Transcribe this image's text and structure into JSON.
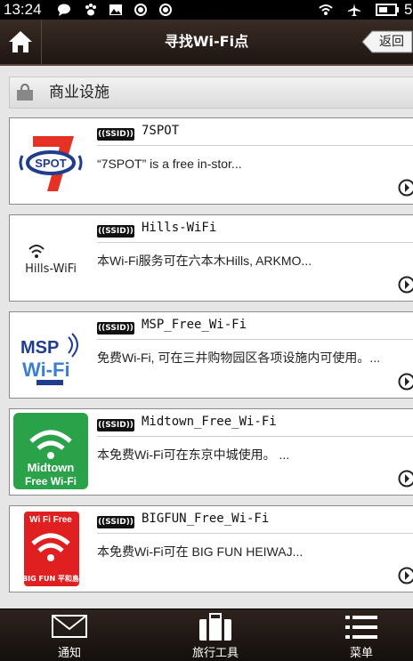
{
  "status_bar": {
    "time": "13:24",
    "battery_partial": "5"
  },
  "header": {
    "title": "寻找Wi-Fi点",
    "back_label": "返回"
  },
  "section": {
    "label": "商业设施"
  },
  "spots": [
    {
      "badge": "SSID",
      "ssid": "7SPOT",
      "desc": "“7SPOT” is a free in-stor...",
      "logo_text": "SPOT"
    },
    {
      "badge": "SSID",
      "ssid": "Hills-WiFi",
      "desc": "本Wi-Fi服务可在六本木Hills, ARKMO...",
      "logo_text": "Hills-WiFi"
    },
    {
      "badge": "SSID",
      "ssid": "MSP_Free_Wi-Fi",
      "desc": "免费Wi-Fi, 可在三井购物园区各项设施内可使用。...",
      "logo_text": "MSP Wi-Fi"
    },
    {
      "badge": "SSID",
      "ssid": "Midtown_Free_Wi-Fi",
      "desc": "本免费Wi-Fi可在东京中城使用。 ...",
      "logo_text_1": "Midtown",
      "logo_text_2": "Free Wi-Fi"
    },
    {
      "badge": "SSID",
      "ssid": "BIGFUN_Free_Wi-Fi",
      "desc": "本免费Wi-Fi可在 BIG FUN HEIWAJ...",
      "logo_text_1": "Wi Fi Free",
      "logo_text_2": "BIG FUN 平和島"
    }
  ],
  "tabs": [
    {
      "label": "通知"
    },
    {
      "label": "旅行工具"
    },
    {
      "label": "菜单"
    }
  ],
  "colors": {
    "header_bg": "#2b1f1a",
    "card_border": "#8a8a8a",
    "midtown_green": "#2aa24a",
    "bigfun_red": "#e02020"
  }
}
